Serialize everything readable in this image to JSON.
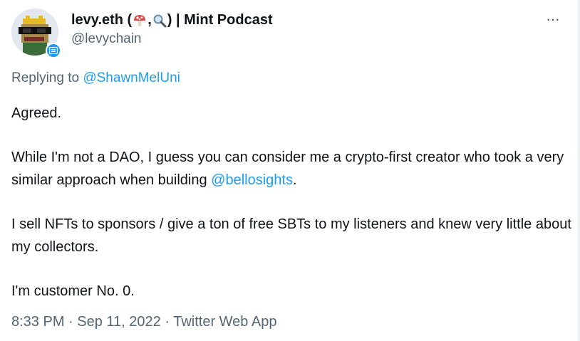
{
  "author": {
    "display_name_prefix": "levy.eth (",
    "display_name_sep": ",",
    "display_name_suffix": ") | Mint Podcast",
    "emoji_1": "mushroom-icon",
    "emoji_2": "magnifier-icon",
    "handle": "@levychain"
  },
  "reply": {
    "prefix": "Replying to ",
    "mention": "@ShawnMelUni"
  },
  "tweet": {
    "p1": "Agreed.",
    "p2_text": "While I'm not a DAO, I guess you can consider me a crypto-first creator who took a very similar approach when building ",
    "p2_mention": "@bellosights",
    "p2_end": ".",
    "p3": "I sell NFTs to sponsors / give a ton of free SBTs to my listeners and knew very little about my collectors.",
    "p4": "I'm customer No. 0."
  },
  "meta": {
    "time": "8:33 PM",
    "sep1": " · ",
    "date": "Sep 11, 2022",
    "sep2": " · ",
    "source": "Twitter Web App"
  },
  "more_icon": "···",
  "colors": {
    "link": "#1d9bf0",
    "muted": "#536471",
    "text": "#0f1419",
    "badge": "#1d9bf0"
  }
}
